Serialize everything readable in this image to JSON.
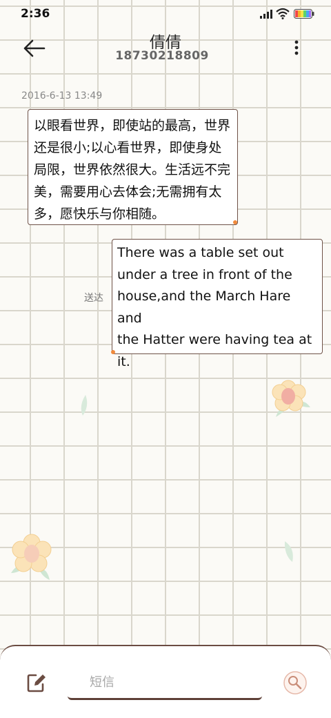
{
  "status_bar": {
    "time": "2:36"
  },
  "header": {
    "contact_name": "倩倩",
    "contact_number": "18730218809"
  },
  "conversation": {
    "timestamp": "2016-6-13 13:49",
    "incoming_message": {
      "lines": [
        "以眼看世界，即使站的最高，世界",
        "还是很小;以心看世界，即使身处",
        "局限，世界依然很大。生活远不完",
        "美，需要用心去体会;无需拥有太",
        "多，愿快乐与你相随。"
      ]
    },
    "outgoing_message": {
      "lines": [
        "There was a table set out",
        "under a tree in front of the",
        "house,and the March Hare and",
        "the Hatter were having tea at",
        "it."
      ],
      "status": "送达"
    }
  },
  "composer": {
    "placeholder": "短信"
  },
  "colors": {
    "accent": "#6e5147",
    "dot": "#f08a3c",
    "grid": "#d9d6cc"
  }
}
